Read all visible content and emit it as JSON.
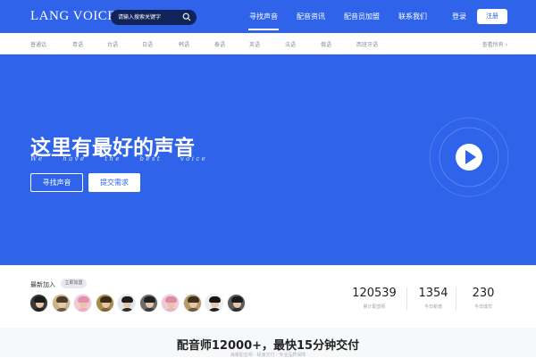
{
  "header": {
    "logo": "LANG VOICE",
    "search_placeholder": "请输入搜索关键字",
    "nav": [
      "寻找声音",
      "配音资讯",
      "配音员加盟",
      "联系我们"
    ],
    "login": "登录",
    "register": "注册"
  },
  "languages": {
    "items": [
      "普通话",
      "粤语",
      "台语",
      "日语",
      "韩语",
      "泰语",
      "英语",
      "法语",
      "俄语",
      "西班牙语"
    ],
    "view_all": "查看所有 ›"
  },
  "hero": {
    "title": "这里有最好的声音",
    "subtitle": "We have the best voice",
    "find_button": "寻找声音",
    "submit_button": "提交需求"
  },
  "stats": {
    "newest_label": "最新加入",
    "badge": "立即加盟",
    "items": [
      {
        "value": "120539",
        "label": "累计配音师"
      },
      {
        "value": "1354",
        "label": "今日新增"
      },
      {
        "value": "230",
        "label": "今日成交"
      }
    ]
  },
  "avatars": [
    {
      "bg": "#3a3a3a",
      "hair": "#1a1a1a",
      "body": "#222222"
    },
    {
      "bg": "#c9b48a",
      "hair": "#4a3b2a",
      "body": "#6b5a40"
    },
    {
      "bg": "#f3c9d8",
      "hair": "#e58fb0",
      "body": "#f0a9c4"
    },
    {
      "bg": "#a88c4c",
      "hair": "#3b2e18",
      "body": "#7a6532"
    },
    {
      "bg": "#dfe6ee",
      "hair": "#1c1c1c",
      "body": "#2a2a2a"
    },
    {
      "bg": "#6c6c6c",
      "hair": "#202020",
      "body": "#3a3a3a"
    },
    {
      "bg": "#f2c8d6",
      "hair": "#d98aa8",
      "body": "#eab1c6"
    },
    {
      "bg": "#b39a66",
      "hair": "#3e3020",
      "body": "#6e5a38"
    },
    {
      "bg": "#e8eef2",
      "hair": "#161616",
      "body": "#1f1f1f"
    },
    {
      "bg": "#5c5c5c",
      "hair": "#1a1a1a",
      "body": "#2e2e2e"
    }
  ],
  "bottom": {
    "title": "配音师12000+，最快15分钟交付",
    "subtitle": "海量配音师 · 极速交付 · 专业品质保障"
  },
  "colors": {
    "brand": "#2f63ea",
    "search_bg": "#10245a"
  }
}
